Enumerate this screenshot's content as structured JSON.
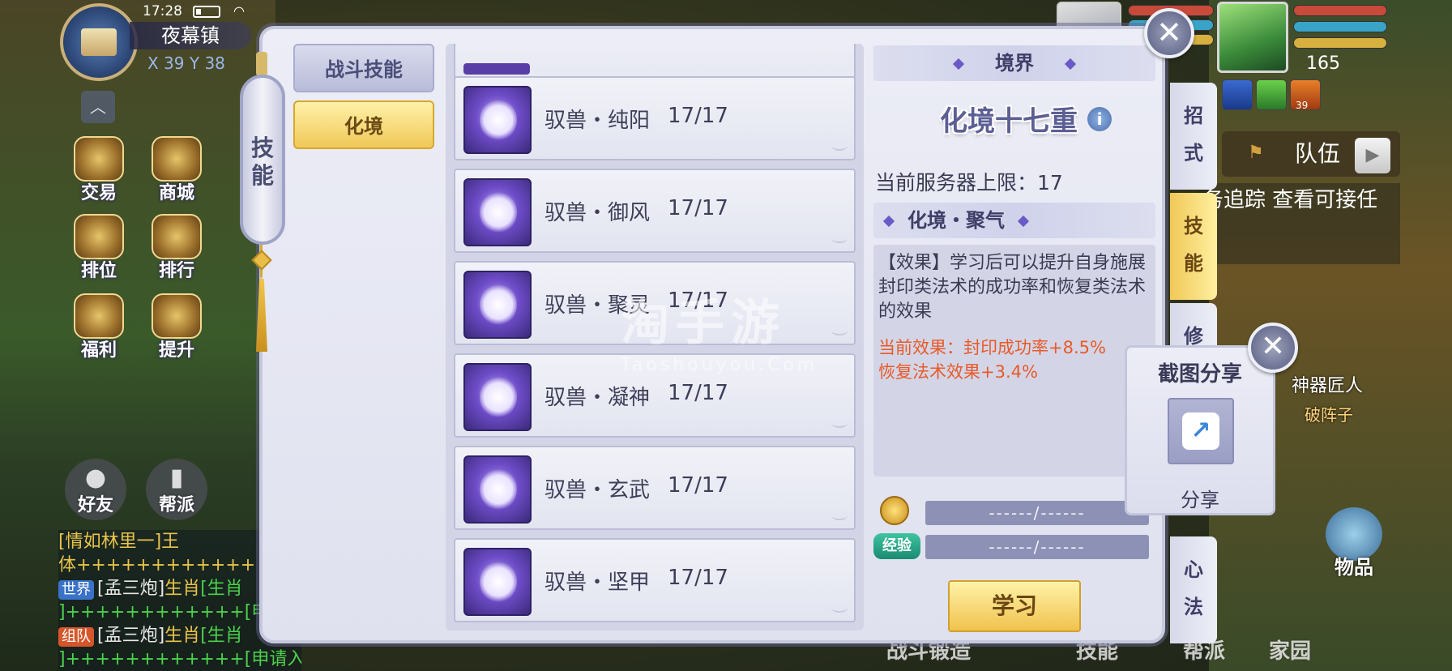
{
  "hud": {
    "time": "17:28",
    "location": "夜幕镇",
    "coords": "X 39  Y 38",
    "collapse_glyph": "︿",
    "buttons": [
      {
        "label": "交易"
      },
      {
        "label": "商城"
      },
      {
        "label": "排位"
      },
      {
        "label": "排行"
      },
      {
        "label": "福利"
      },
      {
        "label": "提升"
      }
    ],
    "friends_label": "好友",
    "guild_label": "帮派",
    "level": "165",
    "buff_level": "39"
  },
  "chat": {
    "lines": [
      {
        "segments": [
          {
            "t": "[情如林里一]王",
            "c": "gold"
          }
        ]
      },
      {
        "segments": [
          {
            "t": "体++++++++++++",
            "c": "gold"
          }
        ]
      },
      {
        "tag": "世界",
        "tag_type": "world",
        "segments": [
          {
            "t": "[孟三炮]",
            "c": "white"
          },
          {
            "t": "生肖",
            "c": "gold"
          },
          {
            "t": "[生肖",
            "c": "green"
          }
        ]
      },
      {
        "segments": [
          {
            "t": "]++++++++++++",
            "c": "green"
          },
          {
            "t": "[申请入",
            "c": "green"
          }
        ]
      },
      {
        "tag": "组队",
        "tag_type": "team",
        "segments": [
          {
            "t": "[孟三炮]",
            "c": "white"
          },
          {
            "t": "生肖",
            "c": "gold"
          },
          {
            "t": "[生肖",
            "c": "green"
          }
        ]
      },
      {
        "segments": [
          {
            "t": "]++++++++++++",
            "c": "green"
          },
          {
            "t": "[申请入队]",
            "c": "green"
          }
        ]
      }
    ]
  },
  "right_hud": {
    "team_label": "队伍",
    "team_arrow": "▶",
    "quest_text": "务追踪 查看可接任",
    "npc_name": "神器匠人",
    "npc_title": "破阵子",
    "items_label": "物品",
    "bottom_menu": [
      "战斗锻造",
      "技能",
      "帮派",
      "家园"
    ]
  },
  "dialog": {
    "vertical_tab": "技能",
    "categories": [
      {
        "label": "战斗技能",
        "active": false
      },
      {
        "label": "化境",
        "active": true
      }
    ],
    "skills": [
      {
        "name": "驭兽・纯阳",
        "level": "17/17"
      },
      {
        "name": "驭兽・御风",
        "level": "17/17"
      },
      {
        "name": "驭兽・聚灵",
        "level": "17/17"
      },
      {
        "name": "驭兽・凝神",
        "level": "17/17"
      },
      {
        "name": "驭兽・玄武",
        "level": "17/17"
      },
      {
        "name": "驭兽・坚甲",
        "level": "17/17"
      }
    ],
    "watermark": "淘手游",
    "watermark_sub": "Taoshouyou.Com",
    "detail": {
      "section_title": "境界",
      "realm_name": "化境十七重",
      "info_glyph": "i",
      "server_limit": "当前服务器上限：17",
      "subsection_title": "化境・聚气",
      "effect_desc": "【效果】学习后可以提升自身施展封印类法术的成功率和恢复类法术的效果",
      "current_effect_1": "当前效果：封印成功率+8.5%",
      "current_effect_2": "恢复法术效果+3.4%",
      "coin_cost": "------/------",
      "exp_label": "经验",
      "exp_cost": "------/------",
      "learn_button": "学习"
    },
    "side_tabs": [
      {
        "label": "招式",
        "active": false
      },
      {
        "label": "技能",
        "active": true
      },
      {
        "label": "修",
        "active": false
      },
      {
        "label": "心法",
        "active": false
      }
    ],
    "close_glyph": "✕"
  },
  "share_popup": {
    "title": "截图分享",
    "icon_glyph": "↗",
    "label": "分享",
    "close_glyph": "✕"
  },
  "colors": {
    "accent_gold": "#f0c858",
    "effect_orange": "#e85a28",
    "panel_lavender": "#d3d5e7"
  }
}
